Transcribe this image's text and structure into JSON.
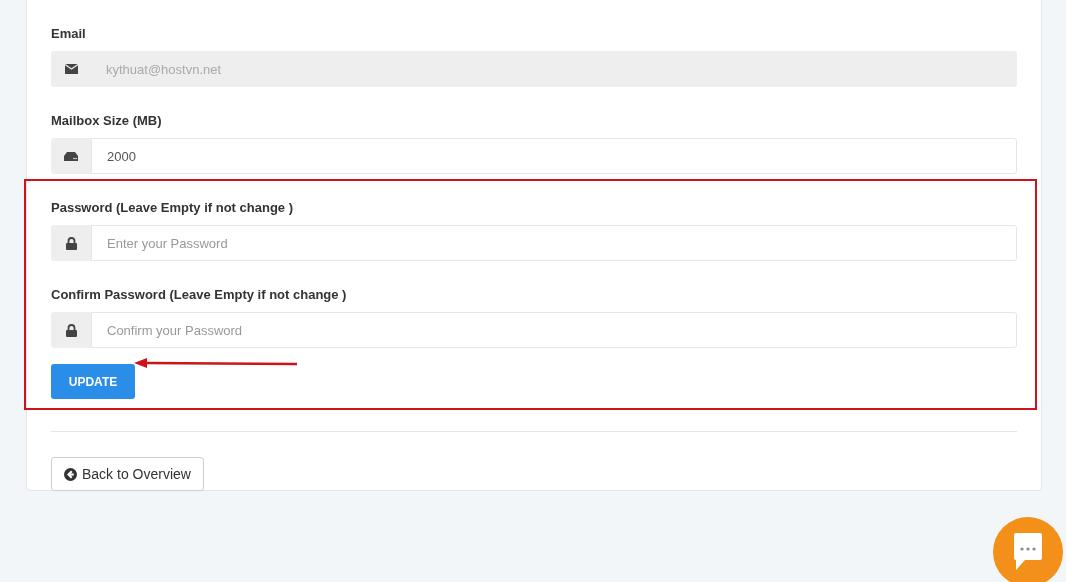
{
  "form": {
    "fields": [
      {
        "label": "Email",
        "kind": "email",
        "value": "kythuat@hostvn.net",
        "disabled": true
      },
      {
        "label": "Mailbox Size (MB)",
        "kind": "storage",
        "value": "2000",
        "disabled": false
      },
      {
        "label": "Password (Leave Empty if not change )",
        "kind": "password",
        "placeholder": "Enter your Password",
        "disabled": false
      },
      {
        "label": "Confirm Password (Leave Empty if not change )",
        "kind": "password",
        "placeholder": "Confirm your Password",
        "disabled": false
      }
    ],
    "submit_button": "UPDATE"
  },
  "back_button": "Back to Overview"
}
